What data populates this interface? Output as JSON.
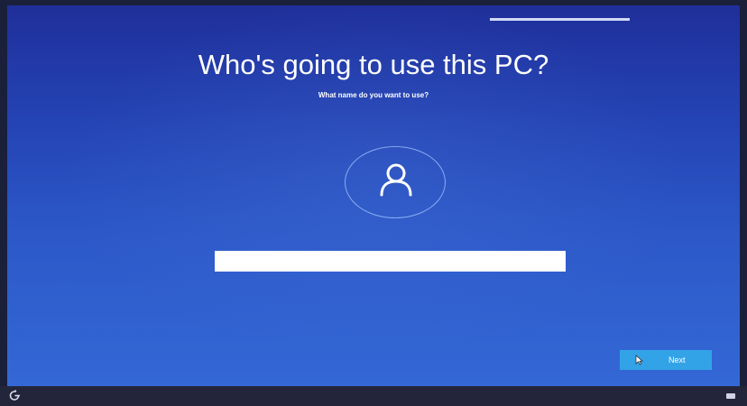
{
  "page": {
    "title": "Who's going to use this PC?",
    "subtitle": "What name do you want to use?"
  },
  "form": {
    "name_input": {
      "value": "",
      "placeholder": ""
    },
    "next_label": "Next"
  },
  "icons": {
    "avatar": "user-icon",
    "ease_of_access": "ease-of-access-icon",
    "keyboard": "keyboard-icon",
    "cursor": "mouse-pointer-icon"
  },
  "colors": {
    "background": "#2443b4",
    "button": "#33a3e8",
    "input": "#ffffff",
    "text": "#ffffff"
  }
}
